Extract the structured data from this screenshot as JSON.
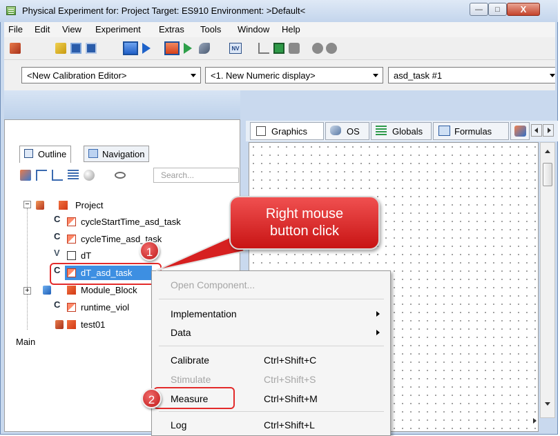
{
  "window": {
    "title": "Physical Experiment for: Project  Target: ES910  Environment: >Default<",
    "close_glyph": "X",
    "minimize_glyph": "—",
    "maximize_glyph": "□"
  },
  "menubar": [
    "File",
    "Edit",
    "View",
    "Experiment",
    "Extras",
    "Tools",
    "Window",
    "Help"
  ],
  "toolbar": {
    "nv_label": "NV"
  },
  "combos": {
    "calibration_editor": "<New Calibration Editor>",
    "numeric_display": "<1. New Numeric display>",
    "task": "asd_task  #1"
  },
  "left_tabs": {
    "outline": "Outline",
    "navigation": "Navigation"
  },
  "search": {
    "placeholder": "Search..."
  },
  "tree": {
    "root": "Project",
    "items": [
      "cycleStartTime_asd_task",
      "cycleTime_asd_task",
      "dT",
      "dT_asd_task",
      "Module_Block",
      "runtime_viol",
      "test01"
    ],
    "main": "Main"
  },
  "right_tabs": [
    "Graphics",
    "OS",
    "Globals",
    "Formulas"
  ],
  "context_menu": {
    "open_component": "Open Component...",
    "implementation": "Implementation",
    "data": "Data",
    "calibrate": "Calibrate",
    "calibrate_sc": "Ctrl+Shift+C",
    "stimulate": "Stimulate",
    "stimulate_sc": "Ctrl+Shift+S",
    "measure": "Measure",
    "measure_sc": "Ctrl+Shift+M",
    "log": "Log",
    "log_sc": "Ctrl+Shift+L"
  },
  "callout": {
    "line1": "Right mouse",
    "line2": "button click"
  },
  "badges": [
    "1",
    "2"
  ],
  "colors": {
    "accent_red": "#d62020",
    "selection": "#3a8ee6",
    "title_bg": "#c3d5ec"
  }
}
